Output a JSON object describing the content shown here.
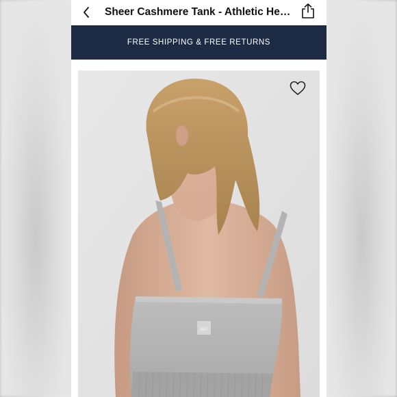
{
  "header": {
    "title": "Sheer Cashmere Tank - Athletic Heather Grey",
    "back_icon": "chevron-left-icon",
    "share_icon": "share-icon"
  },
  "banner": {
    "text": "FREE SHIPPING & FREE RETURNS",
    "background": "#1d2a44"
  },
  "product_image": {
    "favorite_icon": "heart-outline-icon",
    "logo_text": "alo"
  }
}
